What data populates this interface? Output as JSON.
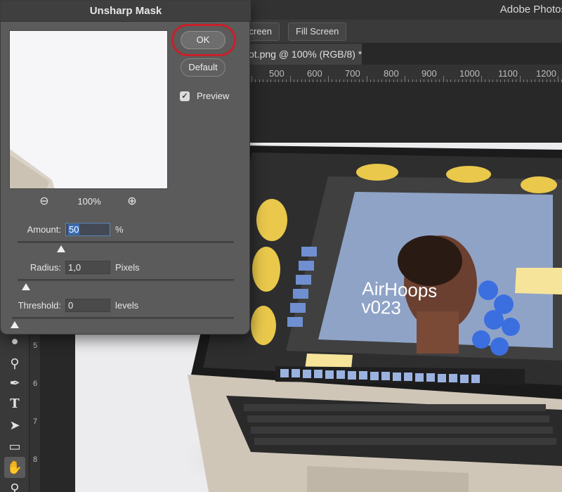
{
  "app": {
    "title": "Adobe Photos"
  },
  "options_bar": {
    "btn1_label": "Screen",
    "btn2_label": "Fill Screen"
  },
  "document": {
    "tab_label": "ot.png @ 100% (RGB/8) *"
  },
  "ruler_h": {
    "labels": [
      "500",
      "600",
      "700",
      "800",
      "900",
      "1000",
      "1100",
      "1200"
    ]
  },
  "ruler_v": {
    "labels": [
      "5",
      "6",
      "7",
      "8"
    ]
  },
  "tools": [
    "brush-icon",
    "eraser-icon",
    "dodge-icon",
    "pen-icon",
    "type-icon",
    "path-selection-icon",
    "rectangle-icon",
    "hand-icon",
    "zoom-icon"
  ],
  "dialog": {
    "title": "Unsharp Mask",
    "ok_label": "OK",
    "default_label": "Default",
    "preview_label": "Preview",
    "preview_checked": true,
    "zoom_level": "100%",
    "amount": {
      "label": "Amount:",
      "value": "50",
      "unit": "%",
      "slider_fraction": 0.2
    },
    "radius": {
      "label": "Radius:",
      "value": "1,0",
      "unit": "Pixels",
      "slider_fraction": 0.04
    },
    "threshold": {
      "label": "Threshold:",
      "value": "0",
      "unit": "levels",
      "slider_fraction": 0.0
    }
  },
  "canvas": {
    "screen_title_line1": "AirHoops",
    "screen_title_line2": "v023"
  },
  "colors": {
    "accent_red": "#c8202a",
    "selection_blue": "#3c6fb6",
    "panel_gray": "#5b5b5b"
  }
}
